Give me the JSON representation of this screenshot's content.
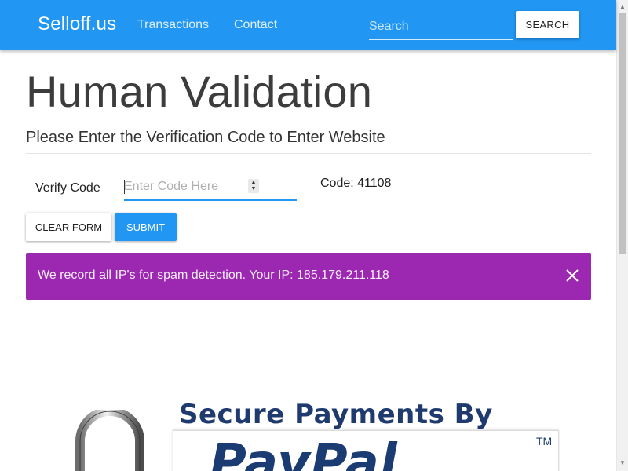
{
  "navbar": {
    "brand": "Selloff.us",
    "links": [
      {
        "label": "Transactions"
      },
      {
        "label": "Contact"
      }
    ],
    "search": {
      "placeholder": "Search",
      "value": "",
      "button_label": "SEARCH"
    },
    "color": "#2196f3"
  },
  "main": {
    "title": "Human Validation",
    "subtitle": "Please Enter the Verification Code to Enter Website",
    "form": {
      "verify_label": "Verify Code",
      "code_input": {
        "placeholder": "Enter Code Here",
        "value": ""
      },
      "code_display": "Code: 41108",
      "clear_button": "CLEAR FORM",
      "submit_button": "SUBMIT"
    },
    "alert": {
      "text": "We record all IP's for spam detection. Your IP: 185.179.211.118",
      "color": "#9c27b0",
      "close_icon": "close-icon"
    },
    "banner": {
      "heading": "Secure Payments By",
      "brand": "PayPal",
      "trademark": "TM",
      "icon": "padlock-icon"
    }
  }
}
